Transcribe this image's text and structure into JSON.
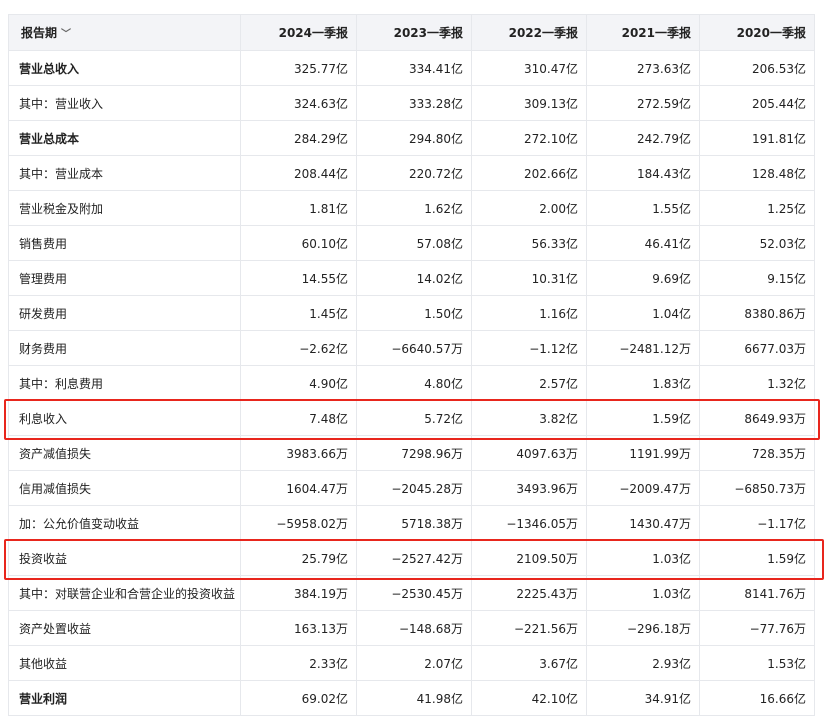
{
  "header": {
    "period_label": "报告期",
    "columns": [
      "2024一季报",
      "2023一季报",
      "2022一季报",
      "2021一季报",
      "2020一季报"
    ]
  },
  "rows": [
    {
      "label": "营业总收入",
      "bold": true,
      "values": [
        "325.77亿",
        "334.41亿",
        "310.47亿",
        "273.63亿",
        "206.53亿"
      ]
    },
    {
      "label": "其中：营业收入",
      "bold": false,
      "values": [
        "324.63亿",
        "333.28亿",
        "309.13亿",
        "272.59亿",
        "205.44亿"
      ]
    },
    {
      "label": "营业总成本",
      "bold": true,
      "values": [
        "284.29亿",
        "294.80亿",
        "272.10亿",
        "242.79亿",
        "191.81亿"
      ]
    },
    {
      "label": "其中：营业成本",
      "bold": false,
      "values": [
        "208.44亿",
        "220.72亿",
        "202.66亿",
        "184.43亿",
        "128.48亿"
      ]
    },
    {
      "label": "营业税金及附加",
      "bold": false,
      "values": [
        "1.81亿",
        "1.62亿",
        "2.00亿",
        "1.55亿",
        "1.25亿"
      ]
    },
    {
      "label": "销售费用",
      "bold": false,
      "values": [
        "60.10亿",
        "57.08亿",
        "56.33亿",
        "46.41亿",
        "52.03亿"
      ]
    },
    {
      "label": "管理费用",
      "bold": false,
      "values": [
        "14.55亿",
        "14.02亿",
        "10.31亿",
        "9.69亿",
        "9.15亿"
      ]
    },
    {
      "label": "研发费用",
      "bold": false,
      "values": [
        "1.45亿",
        "1.50亿",
        "1.16亿",
        "1.04亿",
        "8380.86万"
      ]
    },
    {
      "label": "财务费用",
      "bold": false,
      "values": [
        "−2.62亿",
        "−6640.57万",
        "−1.12亿",
        "−2481.12万",
        "6677.03万"
      ]
    },
    {
      "label": "其中：利息费用",
      "bold": false,
      "values": [
        "4.90亿",
        "4.80亿",
        "2.57亿",
        "1.83亿",
        "1.32亿"
      ]
    },
    {
      "label": "利息收入",
      "bold": false,
      "values": [
        "7.48亿",
        "5.72亿",
        "3.82亿",
        "1.59亿",
        "8649.93万"
      ]
    },
    {
      "label": "资产减值损失",
      "bold": false,
      "values": [
        "3983.66万",
        "7298.96万",
        "4097.63万",
        "1191.99万",
        "728.35万"
      ]
    },
    {
      "label": "信用减值损失",
      "bold": false,
      "values": [
        "1604.47万",
        "−2045.28万",
        "3493.96万",
        "−2009.47万",
        "−6850.73万"
      ]
    },
    {
      "label": "加：公允价值变动收益",
      "bold": false,
      "values": [
        "−5958.02万",
        "5718.38万",
        "−1346.05万",
        "1430.47万",
        "−1.17亿"
      ]
    },
    {
      "label": "投资收益",
      "bold": false,
      "values": [
        "25.79亿",
        "−2527.42万",
        "2109.50万",
        "1.03亿",
        "1.59亿"
      ]
    },
    {
      "label": "其中：对联营企业和合营企业的投资收益",
      "bold": false,
      "values": [
        "384.19万",
        "−2530.45万",
        "2225.43万",
        "1.03亿",
        "8141.76万"
      ]
    },
    {
      "label": "资产处置收益",
      "bold": false,
      "values": [
        "163.13万",
        "−148.68万",
        "−221.56万",
        "−296.18万",
        "−77.76万"
      ]
    },
    {
      "label": "其他收益",
      "bold": false,
      "values": [
        "2.33亿",
        "2.07亿",
        "3.67亿",
        "2.93亿",
        "1.53亿"
      ]
    },
    {
      "label": "营业利润",
      "bold": true,
      "values": [
        "69.02亿",
        "41.98亿",
        "42.10亿",
        "34.91亿",
        "16.66亿"
      ]
    }
  ],
  "highlight_color": "#e8261d"
}
